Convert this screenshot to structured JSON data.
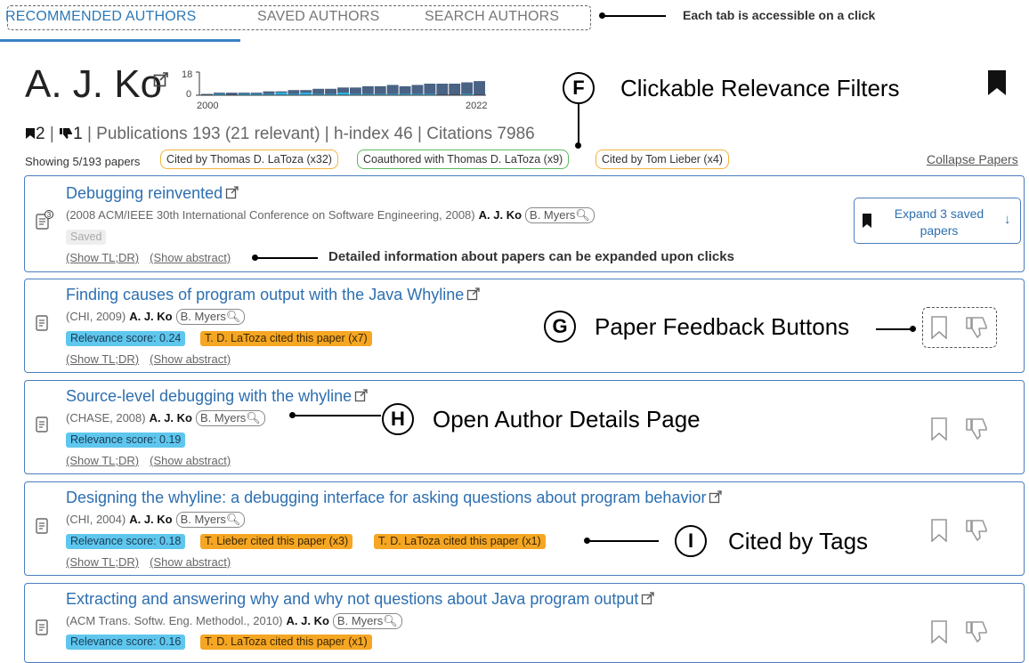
{
  "tabs": {
    "recommended": "RECOMMENDED AUTHORS",
    "saved": "SAVED AUTHORS",
    "search": "SEARCH AUTHORS",
    "annotation": "Each tab is accessible on a click"
  },
  "author": {
    "name": "A. J. Ko",
    "spark_ymax": "18",
    "spark_ymin": "0",
    "spark_start": "2000",
    "spark_end": "2022",
    "saved_count": "2",
    "disliked_count": "1",
    "stats_text": "| Publications 193 (21 relevant) | h-index 46 | Citations 7986"
  },
  "filters": {
    "showing": "Showing 5/193 papers",
    "items": [
      {
        "label": "Cited by Thomas D. LaToza (x32)"
      },
      {
        "label": "Coauthored with Thomas D. LaToza (x9)"
      },
      {
        "label": "Cited by Tom Lieber (x4)"
      }
    ],
    "collapse": "Collapse Papers"
  },
  "annotations": {
    "F_letter": "F",
    "F_text": "Clickable Relevance Filters",
    "G_letter": "G",
    "G_text": "Paper Feedback Buttons",
    "H_letter": "H",
    "H_text": "Open Author Details Page",
    "I_letter": "I",
    "I_text": "Cited by Tags",
    "details_text": "Detailed information about papers can be expanded upon clicks"
  },
  "papers": [
    {
      "title": "Debugging reinvented",
      "venue": "(2008 ACM/IEEE 30th International Conference on Software Engineering, 2008)",
      "author": "A. J. Ko",
      "coauthor": "B. Myers",
      "saved_label": "Saved",
      "saved_badge": "3",
      "expand_label": "Expand 3 saved papers",
      "show_tldr": "(Show TL;DR)",
      "show_abstract": "(Show abstract)"
    },
    {
      "title": "Finding causes of program output with the Java Whyline",
      "venue": "(CHI, 2009)",
      "author": "A. J. Ko",
      "coauthor": "B. Myers",
      "relevance": "Relevance score: 0.24",
      "cited_tags": [
        "T. D. LaToza cited this paper (x7)"
      ],
      "show_tldr": "(Show TL;DR)",
      "show_abstract": "(Show abstract)"
    },
    {
      "title": "Source-level debugging with the whyline",
      "venue": "(CHASE, 2008)",
      "author": "A. J. Ko",
      "coauthor": "B. Myers",
      "relevance": "Relevance score: 0.19",
      "show_tldr": "(Show TL;DR)",
      "show_abstract": "(Show abstract)"
    },
    {
      "title": "Designing the whyline: a debugging interface for asking questions about program behavior",
      "venue": "(CHI, 2004)",
      "author": "A. J. Ko",
      "coauthor": "B. Myers",
      "relevance": "Relevance score: 0.18",
      "cited_tags": [
        "T. Lieber cited this paper (x3)",
        "T. D. LaToza cited this paper (x1)"
      ],
      "show_tldr": "(Show TL;DR)",
      "show_abstract": "(Show abstract)"
    },
    {
      "title": "Extracting and answering why and why not questions about Java program output",
      "venue": "(ACM Trans. Softw. Eng. Methodol., 2010)",
      "author": "A. J. Ko",
      "coauthor": "B. Myers",
      "relevance": "Relevance score: 0.16",
      "cited_tags": [
        "T. D. LaToza cited this paper (x1)"
      ]
    }
  ],
  "colors": {
    "accent": "#2d6fb0",
    "card_border": "#4b7ec0",
    "relevance_tag": "#5fc7ee",
    "cited_tag": "#f5a623",
    "bar_dark": "#4a6283",
    "bar_relevant": "#2cb5e8"
  },
  "publication_histogram": {
    "x_range": [
      2000,
      2022
    ],
    "y_range": [
      0,
      18
    ],
    "total_per_year": [
      1,
      2,
      2,
      2,
      2,
      3,
      3,
      4,
      4,
      5,
      5,
      6,
      6,
      7,
      7,
      8,
      7,
      8,
      9,
      9,
      9,
      10,
      11
    ],
    "relevant_per_year": [
      0,
      1,
      0,
      1,
      1,
      1,
      2,
      1,
      2,
      1,
      1,
      2,
      1,
      1,
      1,
      1,
      1,
      1,
      1,
      0,
      0,
      1,
      0
    ]
  }
}
